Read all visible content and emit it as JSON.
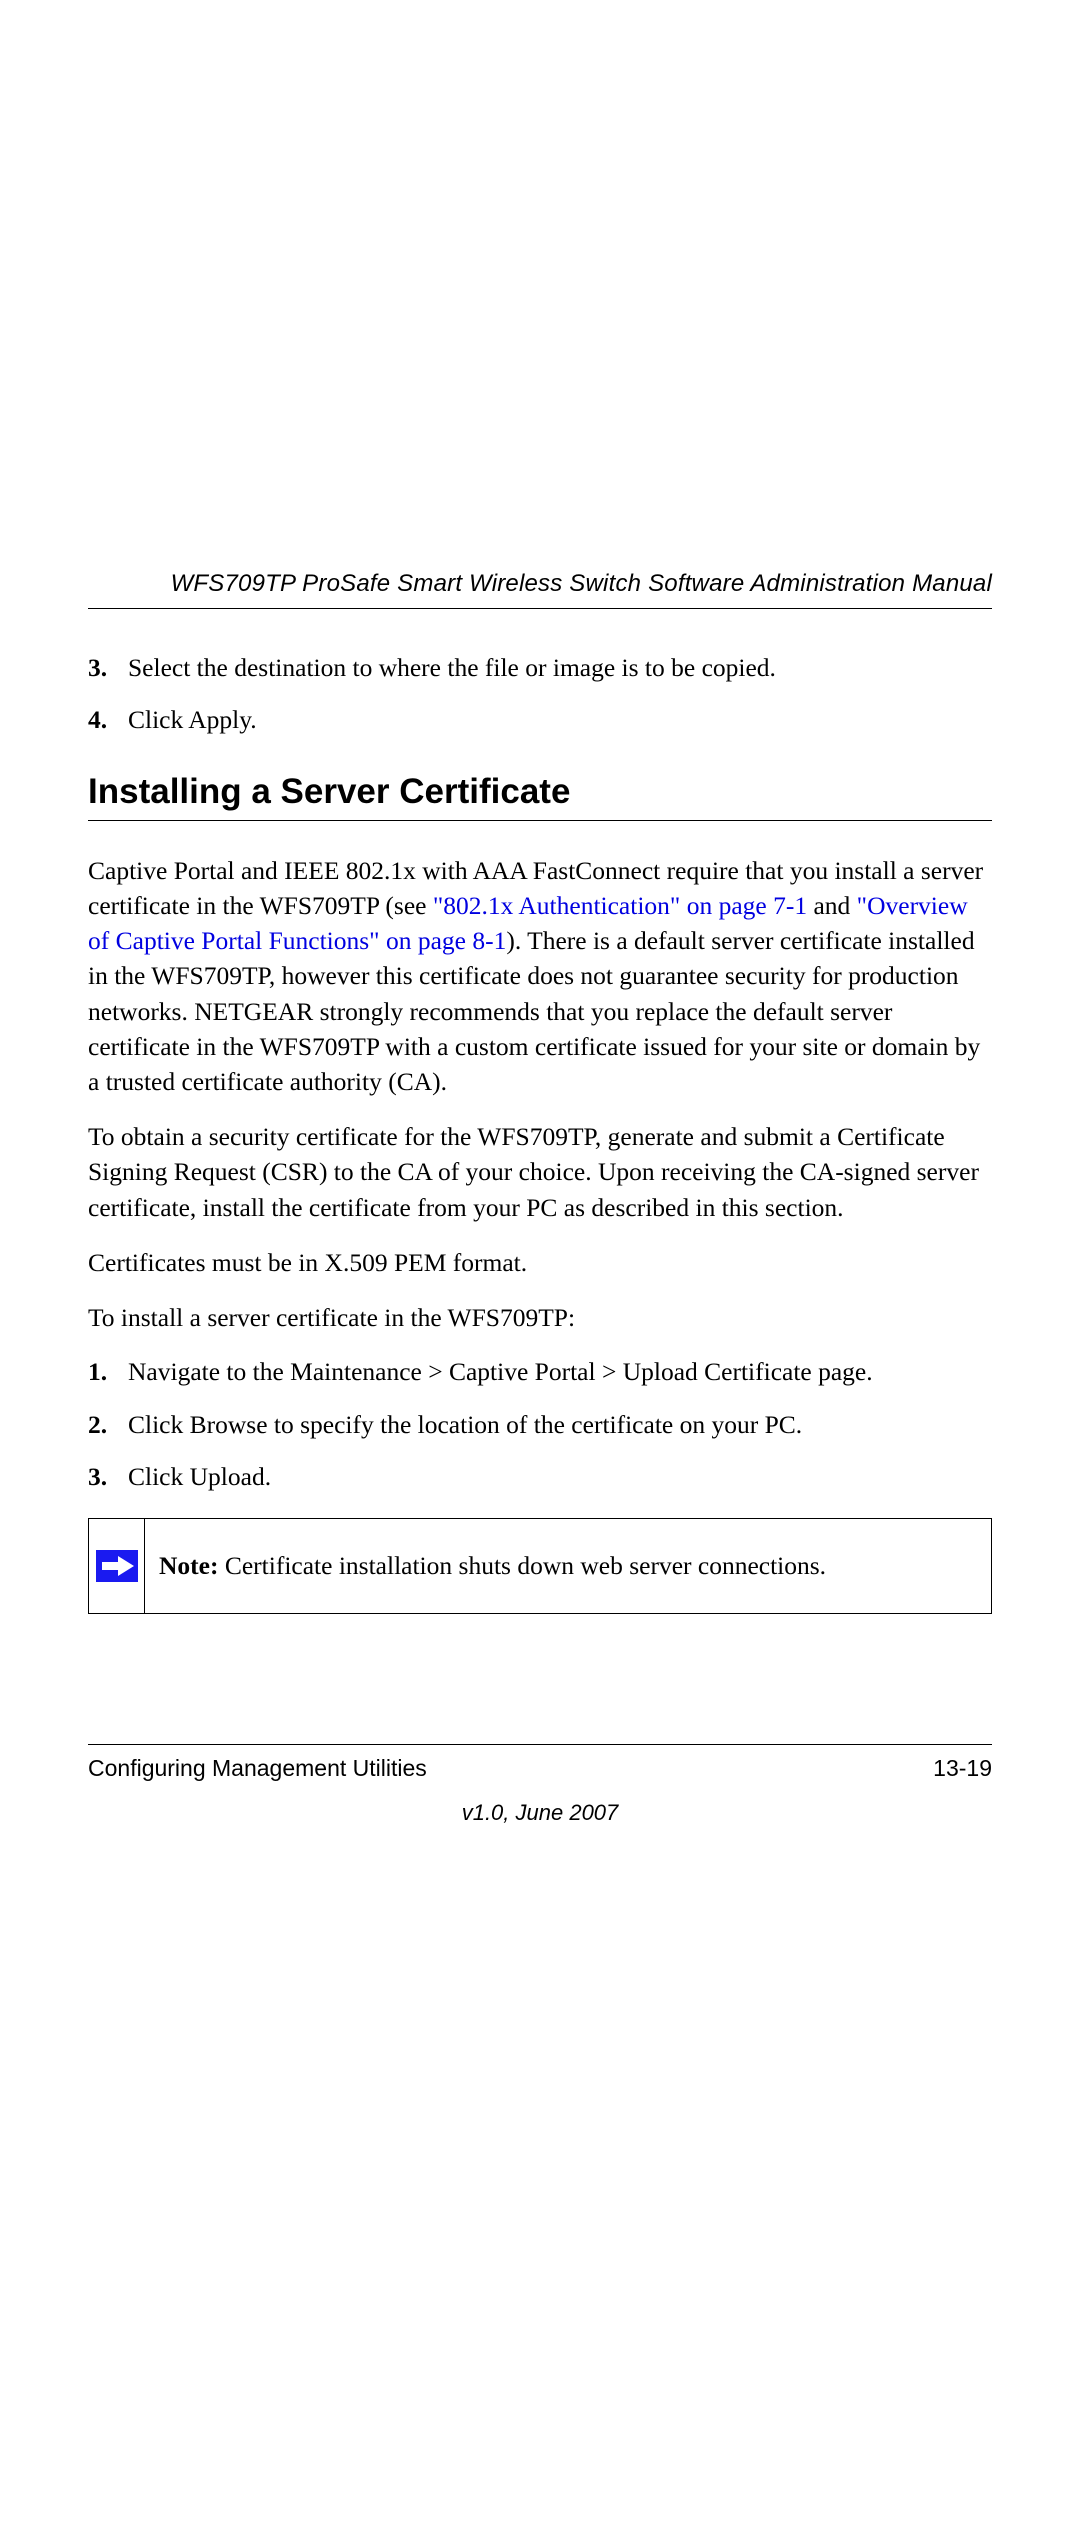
{
  "header": {
    "manual_title": "WFS709TP ProSafe Smart Wireless Switch Software Administration Manual"
  },
  "ol_top": [
    {
      "num": "3.",
      "text": "Select the destination to where the file or image is to be copied."
    },
    {
      "num": "4.",
      "text": "Click Apply."
    }
  ],
  "section": {
    "heading": "Installing a Server Certificate"
  },
  "para1": {
    "pre": "Captive Portal and IEEE 802.1x with AAA FastConnect require that you install a server certificate in the WFS709TP (see ",
    "link1": "\"802.1x Authentication\" on page 7-1",
    "mid": " and ",
    "link2": "\"Overview of Captive Portal Functions\" on page 8-1",
    "post": "). There is a default server certificate installed in the WFS709TP, however this certificate does not guarantee security for production networks. NETGEAR strongly recommends that you replace the default server certificate in the WFS709TP with a custom certificate issued for your site or domain by a trusted certificate authority (CA)."
  },
  "para2": "To obtain a security certificate for the WFS709TP, generate and submit a Certificate Signing Request (CSR) to the CA of your choice. Upon receiving the CA-signed server certificate, install the certificate from your PC as described in this section.",
  "para3": "Certificates must be in X.509 PEM format.",
  "para4": "To install a server certificate in the WFS709TP:",
  "ol_steps": [
    {
      "num": "1.",
      "text": "Navigate to the Maintenance > Captive Portal > Upload Certificate page."
    },
    {
      "num": "2.",
      "text": "Click Browse to specify the location of the certificate on your PC."
    },
    {
      "num": "3.",
      "text": "Click Upload."
    }
  ],
  "note": {
    "label": "Note:",
    "text": " Certificate installation shuts down web server connections."
  },
  "footer": {
    "left": "Configuring Management Utilities",
    "right": "13-19",
    "version": "v1.0, June 2007"
  }
}
